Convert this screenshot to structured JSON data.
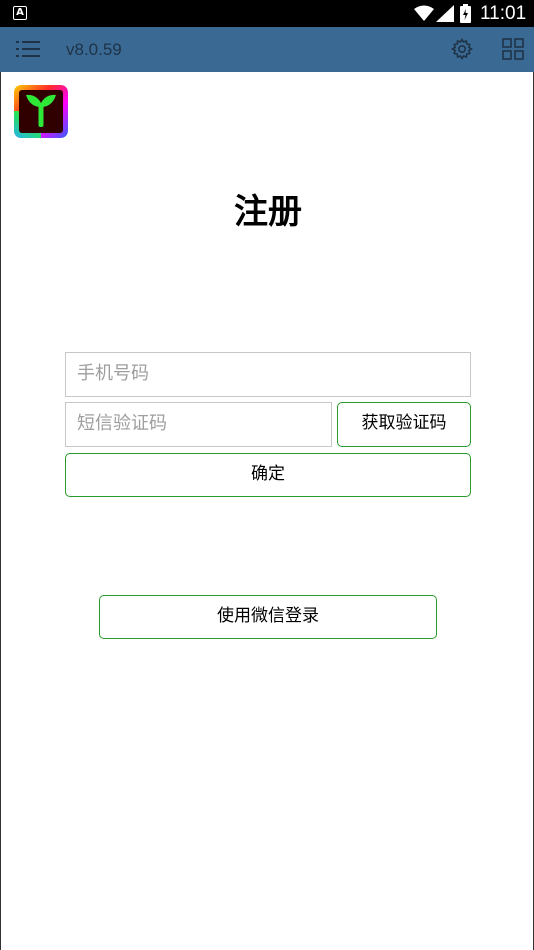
{
  "status_bar": {
    "app_badge": "A",
    "time": "11:01",
    "icons": [
      "wifi-icon",
      "cell-signal-icon",
      "battery-charging-icon"
    ]
  },
  "toolbar": {
    "version": "v8.0.59",
    "icons": [
      "menu-icon",
      "gear-icon",
      "grid-icon"
    ],
    "background_color": "#3a6a93"
  },
  "logo": {
    "icon": "sprout-logo"
  },
  "page": {
    "title": "注册"
  },
  "form": {
    "phone_placeholder": "手机号码",
    "code_placeholder": "短信验证码",
    "get_code_label": "获取验证码",
    "confirm_label": "确定"
  },
  "wechat": {
    "label": "使用微信登录"
  },
  "colors": {
    "accent_border": "#2a9a2a",
    "input_border": "#c8c8c8"
  }
}
